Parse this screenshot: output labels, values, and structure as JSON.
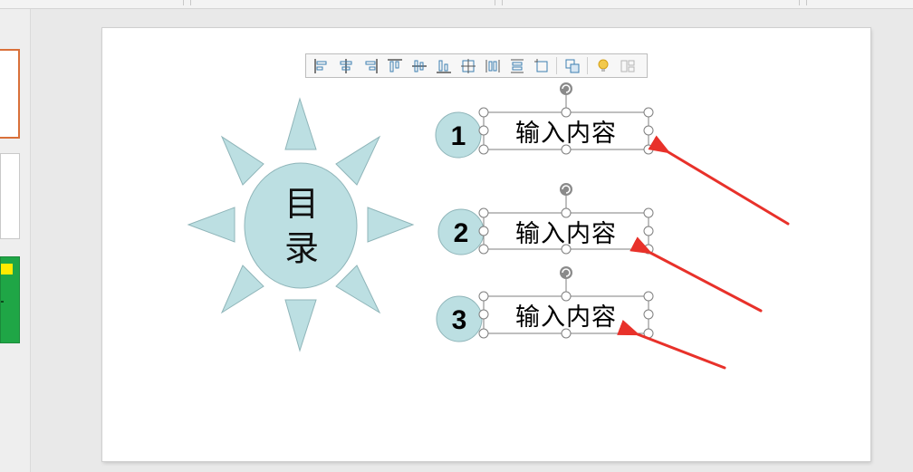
{
  "slide": {
    "title_chars": [
      "目",
      "录"
    ],
    "items": [
      {
        "number": "1",
        "text": "输入内容"
      },
      {
        "number": "2",
        "text": "输入内容"
      },
      {
        "number": "3",
        "text": "输入内容"
      }
    ]
  },
  "align_toolbar": {
    "buttons": [
      "align-left-icon",
      "align-center-icon",
      "align-right-icon",
      "align-top-icon",
      "align-middle-icon",
      "align-bottom-icon",
      "align-center-both-icon",
      "distribute-horizontally-icon",
      "distribute-vertically-icon",
      "align-to-slide-icon",
      "group-icon",
      "smart-idea-icon",
      "more-layout-icon"
    ]
  },
  "colors": {
    "shape_fill": "#bcdfe2",
    "shape_stroke": "#8fb5b9",
    "arrow": "#e8312a",
    "handle": "#7f7f7f",
    "accent_thumb": "#d9703a",
    "thumb_green": "#1fa646",
    "thumb_yellow": "#ffea00"
  }
}
